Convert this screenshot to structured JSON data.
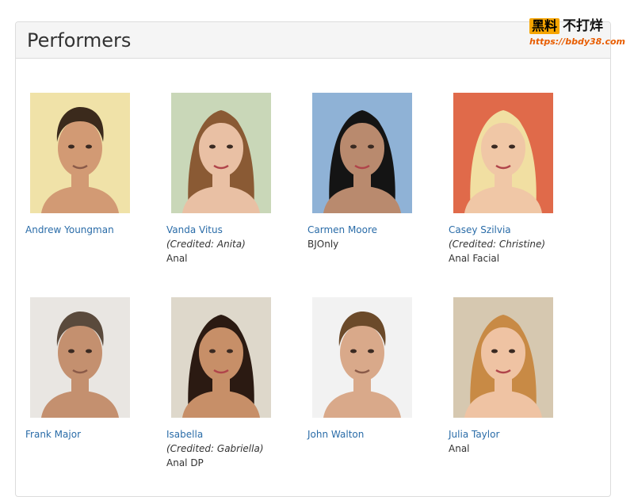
{
  "panel": {
    "title": "Performers"
  },
  "watermark": {
    "badge": "黑料",
    "text": "不打烊",
    "url": "https://bbdy38.com"
  },
  "performers": [
    {
      "name": "Andrew Youngman",
      "credited": "",
      "tags": "",
      "icon": "male-portrait",
      "bg": "#f0e2a8",
      "skin": "#d29a74",
      "hair": "#3b2a1c"
    },
    {
      "name": "Vanda Vitus",
      "credited": "(Credited: Anita)",
      "tags": "Anal",
      "icon": "female-portrait",
      "bg": "#c9d7b8",
      "skin": "#e9c0a4",
      "hair": "#8a5a34"
    },
    {
      "name": "Carmen Moore",
      "credited": "",
      "tags": "BJOnly",
      "icon": "female-portrait",
      "bg": "#8fb2d6",
      "skin": "#b98a6e",
      "hair": "#141414"
    },
    {
      "name": "Casey Szilvia",
      "credited": "(Credited: Christine)",
      "tags": "Anal Facial",
      "icon": "female-portrait",
      "bg": "#e06a4a",
      "skin": "#f0c7a6",
      "hair": "#f1dfa2"
    },
    {
      "name": "Frank Major",
      "credited": "",
      "tags": "",
      "icon": "male-portrait",
      "bg": "#e9e6e2",
      "skin": "#c4906f",
      "hair": "#5a4a3c"
    },
    {
      "name": "Isabella",
      "credited": "(Credited: Gabriella)",
      "tags": "Anal DP",
      "icon": "female-portrait",
      "bg": "#ded8cb",
      "skin": "#c78f68",
      "hair": "#2b1a12"
    },
    {
      "name": "John Walton",
      "credited": "",
      "tags": "",
      "icon": "male-portrait",
      "bg": "#f2f2f2",
      "skin": "#d9a98a",
      "hair": "#6b4a2a"
    },
    {
      "name": "Julia Taylor",
      "credited": "",
      "tags": "Anal",
      "icon": "female-portrait",
      "bg": "#d6c8b0",
      "skin": "#efc3a3",
      "hair": "#c88a45"
    }
  ]
}
